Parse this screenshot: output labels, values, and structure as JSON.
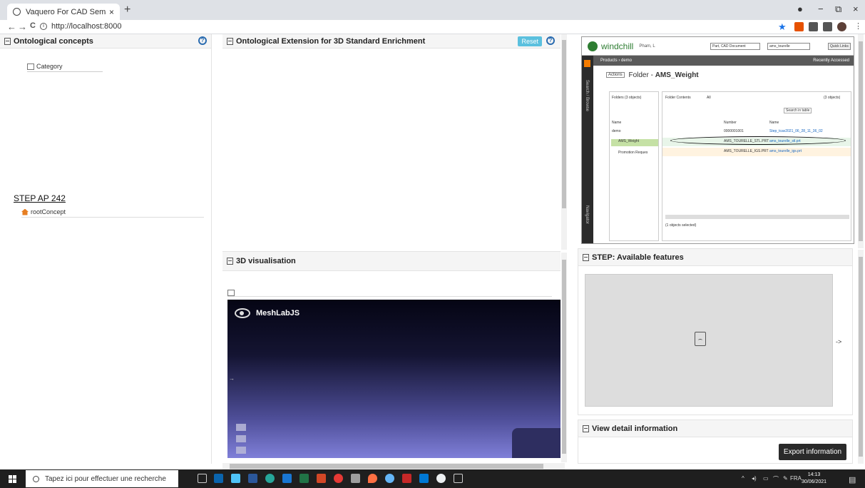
{
  "browser": {
    "tab_title": "Vaquero For CAD Semantic Enric",
    "tab_close": "×",
    "new_tab": "+",
    "url": "http://localhost:8000",
    "nav_back": "←",
    "nav_forward": "→",
    "nav_reload": "C",
    "window_controls": [
      "−",
      "⧉",
      "×"
    ]
  },
  "panels": {
    "ontological_concepts": {
      "title": "Ontological concepts",
      "category": "Category",
      "step_link": "STEP AP 242",
      "root_concept": "rootConcept"
    },
    "ontological_extension": {
      "title": "Ontological Extension for 3D Standard Enrichment",
      "reset_label": "Reset"
    },
    "visualisation": {
      "title": "3D visualisation",
      "viewer_brand": "MeshLabJS"
    },
    "step_features": {
      "title": "STEP: Available features",
      "arrow_text": "->"
    },
    "detail_info": {
      "title": "View detail information",
      "export_label": "Export information"
    }
  },
  "windchill": {
    "brand": "windchill",
    "user": "Pham, L",
    "search_type": "Part, CAD Document",
    "search_value": "ams_tourelle",
    "quick_links": "Quick Links",
    "breadcrumb": "Products › demo",
    "recently_accessed": "Recently Accessed",
    "actions": "Actions",
    "folder_prefix": "Folder - ",
    "folder_name": "AMS_Weight",
    "side_search": "Search / Browse",
    "side_navigator": "Navigator",
    "folders_label": "Folders (3 objects)",
    "folder_contents_label": "Folder Contents",
    "filter_all": "All",
    "objects_count": "(3 objects)",
    "search_in_table": "Search in table",
    "col_name": "Name",
    "col_number": "Number",
    "tree": [
      "demo",
      "AMS_Weight",
      "Promotion Reques"
    ],
    "rows": [
      {
        "number": "0000001001",
        "name": "Step_tcav2021_06_28_11_36_02"
      },
      {
        "number": "AMS_TOURELLE_STL.PRT",
        "name": "ams_tourelle_stl.prt"
      },
      {
        "number": "AMS_TOURELLE_IGS.PRT",
        "name": "ams_tourelle_igs.prt"
      }
    ],
    "selected": "(1 objects selected)"
  },
  "taskbar": {
    "search_placeholder": "Tapez ici pour effectuer une recherche",
    "language": "FRA",
    "time": "14:13",
    "date": "30/06/2021"
  },
  "colors": {
    "reset_button": "#5bc0de",
    "help_icon": "#2b6cb0",
    "export_button": "#2a2a2a",
    "windchill_green": "#2e7d32",
    "taskbar": "#1f1f1f"
  }
}
